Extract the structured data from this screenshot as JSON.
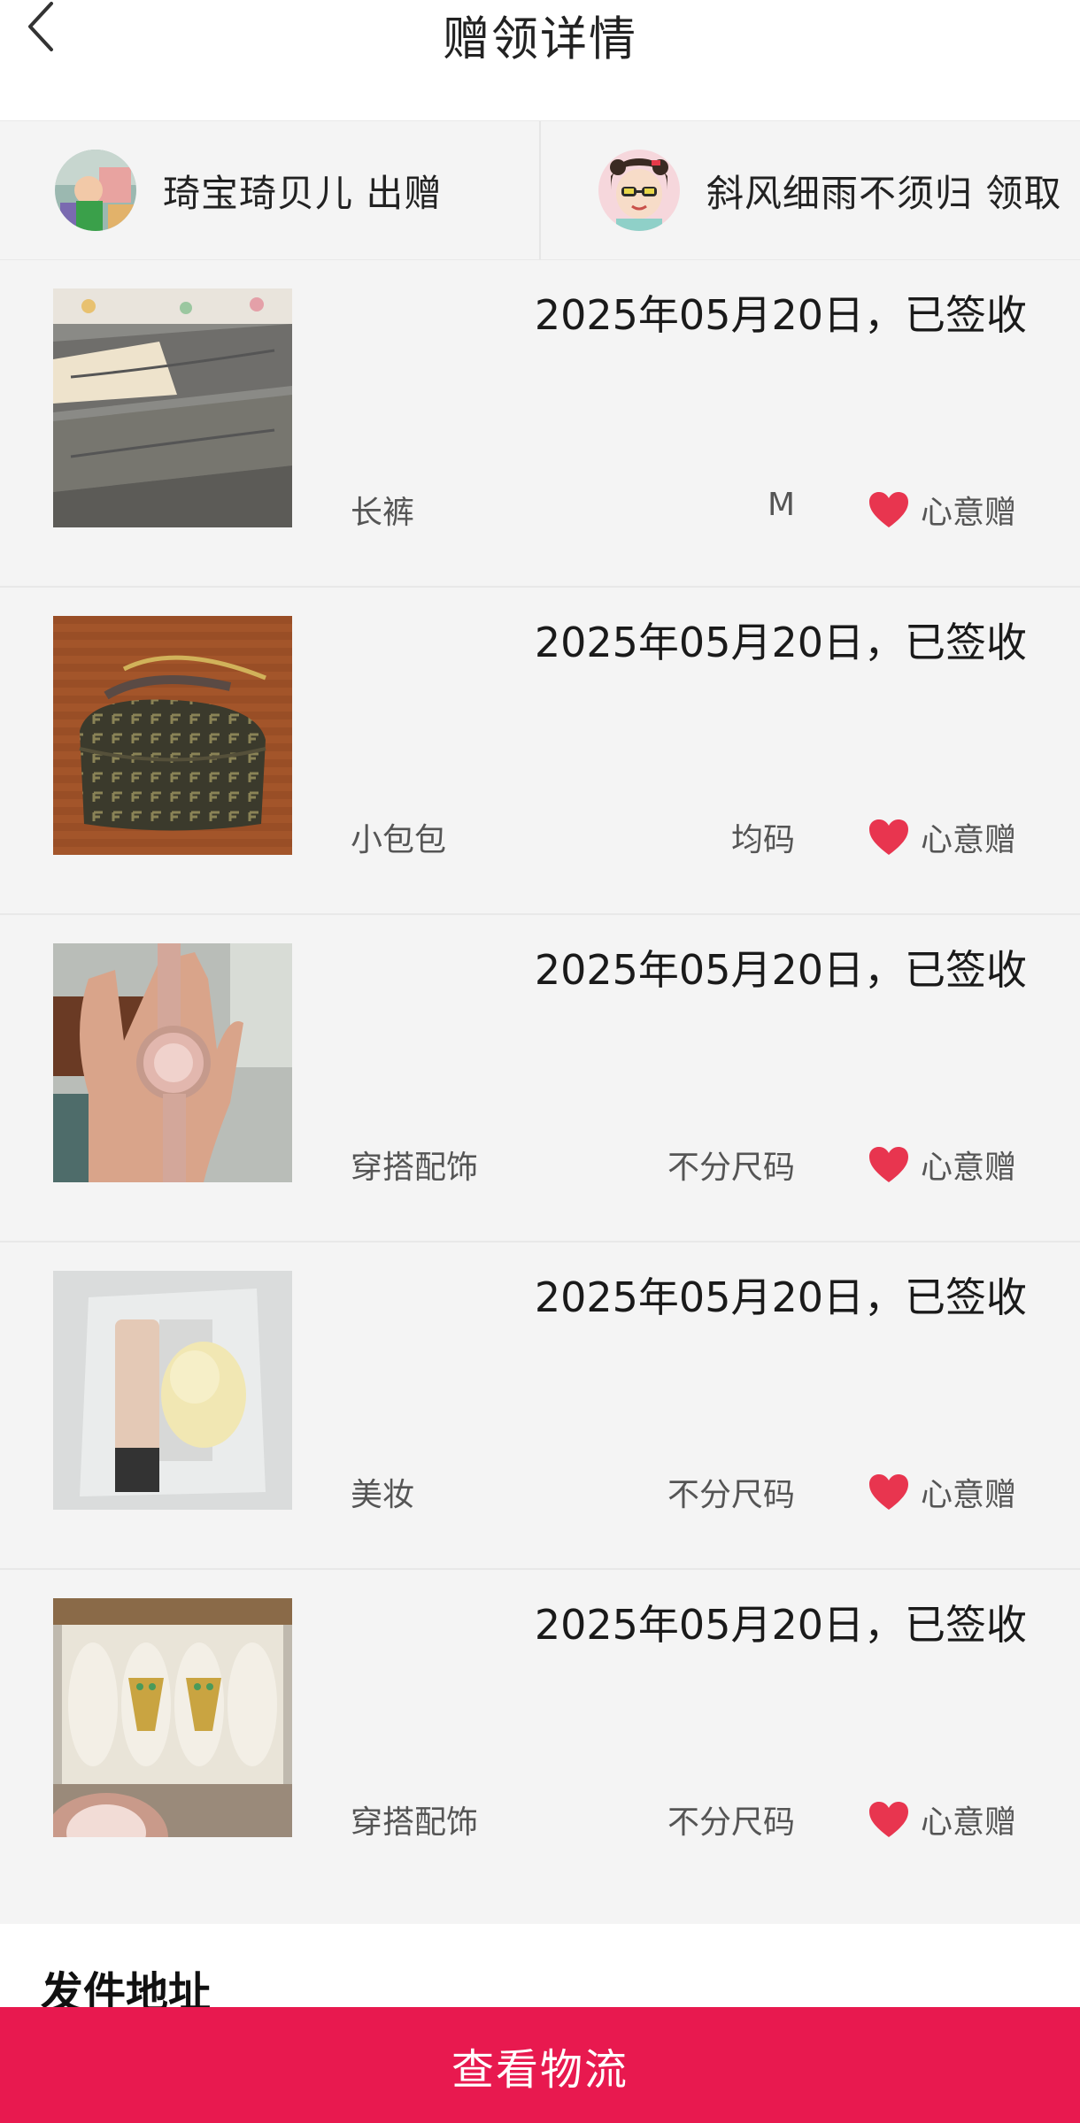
{
  "header": {
    "title": "赠领详情"
  },
  "parties": {
    "giver": {
      "name": "琦宝琦贝儿",
      "action": "出赠"
    },
    "receiver": {
      "name": "斜风细雨不须归",
      "action": "领取"
    }
  },
  "items": [
    {
      "date_status": "2025年05月20日，已签收",
      "category": "长裤",
      "size": "M",
      "tag": "心意赠"
    },
    {
      "date_status": "2025年05月20日，已签收",
      "category": "小包包",
      "size": "均码",
      "tag": "心意赠"
    },
    {
      "date_status": "2025年05月20日，已签收",
      "category": "穿搭配饰",
      "size": "不分尺码",
      "tag": "心意赠"
    },
    {
      "date_status": "2025年05月20日，已签收",
      "category": "美妆",
      "size": "不分尺码",
      "tag": "心意赠"
    },
    {
      "date_status": "2025年05月20日，已签收",
      "category": "穿搭配饰",
      "size": "不分尺码",
      "tag": "心意赠"
    }
  ],
  "address": {
    "title": "发件地址"
  },
  "footer": {
    "logistics_label": "查看物流"
  },
  "colors": {
    "accent": "#e8194f",
    "heart": "#e8354f",
    "background": "#f4f4f4"
  },
  "icons": {
    "back": "chevron-left-icon",
    "tag": "heart-icon"
  }
}
